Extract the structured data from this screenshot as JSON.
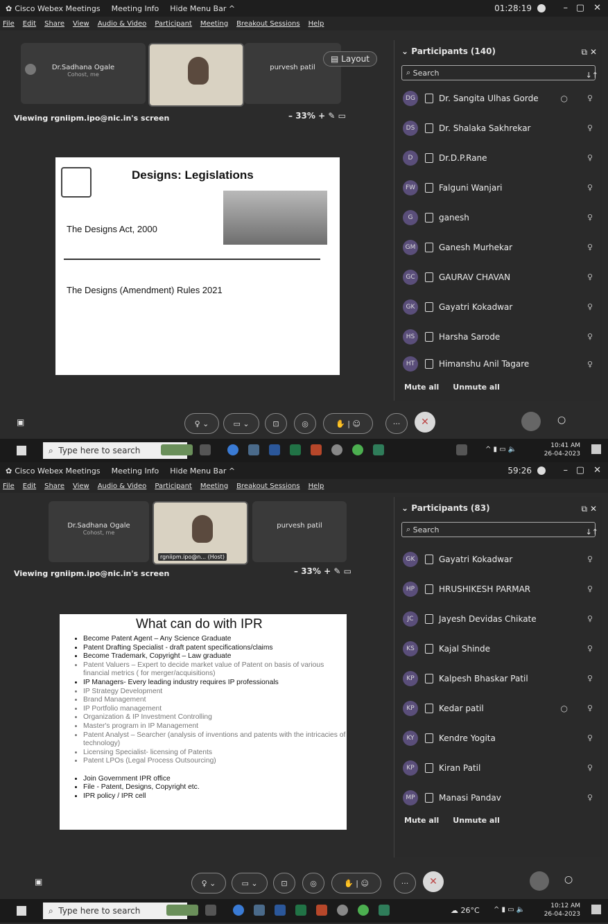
{
  "shot1": {
    "titlebar": {
      "app": "Cisco Webex Meetings",
      "info": "Meeting Info",
      "hide": "Hide Menu Bar ^",
      "timer": "01:28:19"
    },
    "menu": [
      "File",
      "Edit",
      "Share",
      "View",
      "Audio & Video",
      "Participant",
      "Meeting",
      "Breakout Sessions",
      "Help"
    ],
    "thumbs": {
      "left_name": "Dr.Sadhana Ogale",
      "left_sub": "Cohost, me",
      "right_name": "purvesh patil",
      "layout": "Layout"
    },
    "viewing": "Viewing rgniipm.ipo@nic.in's screen",
    "zoom": "33%",
    "slide": {
      "title": "Designs: Legislations",
      "line1": "The Designs Act, 2000",
      "line2": "The Designs (Amendment) Rules 2021"
    },
    "panel": {
      "title": "Participants",
      "count": "(140)",
      "search": "Search",
      "participants": [
        {
          "initials": "DG",
          "name": "Dr. Sangita Ulhas Gorde"
        },
        {
          "initials": "DS",
          "name": "Dr. Shalaka Sakhrekar"
        },
        {
          "initials": "D",
          "name": "Dr.D.P.Rane"
        },
        {
          "initials": "FW",
          "name": "Falguni Wanjari"
        },
        {
          "initials": "G",
          "name": "ganesh"
        },
        {
          "initials": "GM",
          "name": "Ganesh Murhekar"
        },
        {
          "initials": "GC",
          "name": "GAURAV CHAVAN"
        },
        {
          "initials": "GK",
          "name": "Gayatri Kokadwar"
        },
        {
          "initials": "HS",
          "name": "Harsha Sarode"
        },
        {
          "initials": "HT",
          "name": "Himanshu Anil Tagare"
        }
      ],
      "mute_all": "Mute all",
      "unmute_all": "Unmute all"
    },
    "taskbar": {
      "search": "Type here to search",
      "time": "10:41 AM",
      "date": "26-04-2023"
    }
  },
  "shot2": {
    "titlebar": {
      "app": "Cisco Webex Meetings",
      "info": "Meeting Info",
      "hide": "Hide Menu Bar ^",
      "timer": "59:26"
    },
    "menu": [
      "File",
      "Edit",
      "Share",
      "View",
      "Audio & Video",
      "Participant",
      "Meeting",
      "Breakout Sessions",
      "Help"
    ],
    "thumbs": {
      "left_name": "Dr.Sadhana Ogale",
      "left_sub": "Cohost, me",
      "host_label": "rgniipm.ipo@n... (Host)",
      "right_name": "purvesh patil"
    },
    "viewing": "Viewing rgniipm.ipo@nic.in's screen",
    "zoom": "33%",
    "slide": {
      "title": "What can do with IPR",
      "bullets": [
        "Become Patent Agent – Any Science Graduate",
        "Patent Drafting Specialist - draft patent specifications/claims",
        "Become Trademark,  Copyright – Law graduate",
        "Patent Valuers – Expert to decide market value of Patent on basis of various financial metrics ( for merger/acquisitions)",
        "IP Managers- Every leading industry requires IP professionals",
        "IP Strategy Development",
        "Brand Management",
        "IP Portfolio management",
        "Organization & IP Investment Controlling",
        "Master's program in IP Management",
        "Patent Analyst – Searcher (analysis of inventions and patents with the intricacies of technology)",
        "Licensing Specialist- licensing of Patents",
        "Patent LPOs (Legal Process Outsourcing)",
        "",
        "Join Government IPR office",
        "File - Patent, Designs, Copyright etc.",
        "IPR policy / IPR cell"
      ]
    },
    "panel": {
      "title": "Participants",
      "count": "(83)",
      "search": "Search",
      "participants": [
        {
          "initials": "GK",
          "name": "Gayatri Kokadwar"
        },
        {
          "initials": "HP",
          "name": "HRUSHIKESH PARMAR"
        },
        {
          "initials": "JC",
          "name": "Jayesh Devidas Chikate"
        },
        {
          "initials": "KS",
          "name": "Kajal Shinde"
        },
        {
          "initials": "KP",
          "name": "Kalpesh Bhaskar Patil"
        },
        {
          "initials": "KP",
          "name": "Kedar patil"
        },
        {
          "initials": "KY",
          "name": "Kendre Yogita"
        },
        {
          "initials": "KP",
          "name": "Kiran Patil"
        },
        {
          "initials": "MP",
          "name": "Manasi Pandav"
        }
      ],
      "mute_all": "Mute all",
      "unmute_all": "Unmute all"
    },
    "taskbar": {
      "search": "Type here to search",
      "weather": "26°C",
      "time": "10:12 AM",
      "date": "26-04-2023"
    }
  }
}
